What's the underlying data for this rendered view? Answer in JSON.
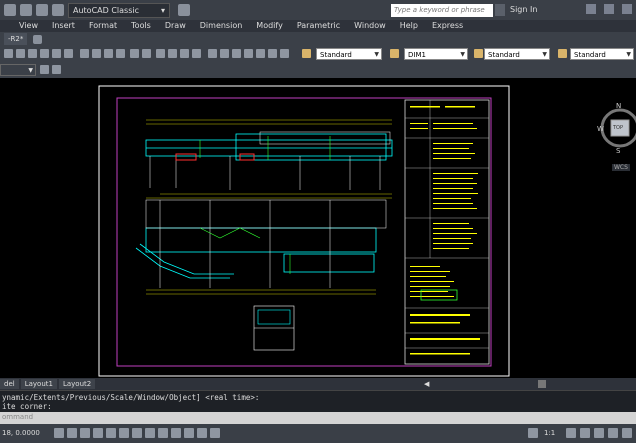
{
  "app": {
    "workspace": "AutoCAD Classic",
    "search_placeholder": "Type a keyword or phrase",
    "signin": "Sign In"
  },
  "menu": [
    "View",
    "Insert",
    "Format",
    "Tools",
    "Draw",
    "Dimension",
    "Modify",
    "Parametric",
    "Window",
    "Help",
    "Express"
  ],
  "doc_tab": "-R2*",
  "styles": {
    "text_style": "Standard",
    "dim_style": "DIM1",
    "table_style": "Standard",
    "mleader_style": "Standard"
  },
  "viewcube": {
    "n": "N",
    "w": "W",
    "s": "S",
    "top": "TOP",
    "ucs": "WCS"
  },
  "layout_tabs": [
    "del",
    "Layout1",
    "Layout2"
  ],
  "command": {
    "line1": "ynamic/Extents/Previous/Scale/Window/Object] <real time>:",
    "line2": "ite corner:",
    "input_placeholder": "ommand"
  },
  "status": {
    "coords": "18, 0.0000",
    "scale": "1:1"
  }
}
